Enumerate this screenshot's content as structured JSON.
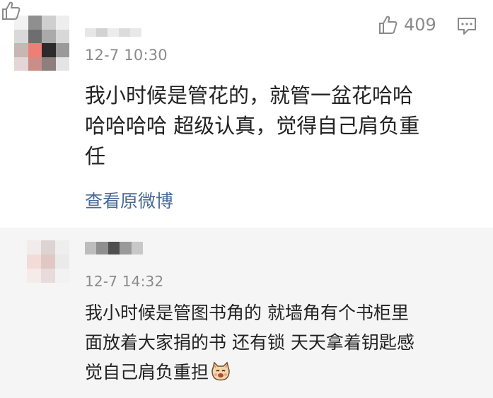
{
  "comments": [
    {
      "time": "12-7 10:30",
      "text_lines": [
        "我小时候是管花的，就管一盆花哈哈",
        "哈哈哈哈 超级认真，觉得自己肩负重",
        "任"
      ],
      "like_count": "409",
      "link_label": "查看原微博",
      "avatar_tiles": [
        "#f2f2f2",
        "#8f8f8f",
        "#cfcfcf",
        "#eeeeee",
        "#d9d9d9",
        "#6e6e6e",
        "#aaaaaa",
        "#d8d8d8",
        "#c7b6b4",
        "#ef7f76",
        "#2b2b2b",
        "#9a9a9a",
        "#e3d6d4",
        "#c98e88",
        "#8c7f7d",
        "#e4e4e4"
      ],
      "name_tiles": [
        "#e6e6e6",
        "#d2d2d2",
        "#ececec",
        "#dcdcdc",
        "#e8e8e8"
      ]
    },
    {
      "time": "12-7 14:32",
      "text_lines": [
        "我小时候是管图书角的 就墙角有个书柜里",
        "面放着大家捐的书 还有锁 天天拿着钥匙感",
        "觉自己肩负重担"
      ],
      "avatar_tiles": [
        "#f1eceb",
        "#dcd3d2",
        "#eeeeee",
        "#f3dcd8",
        "#e2c8c5",
        "#eaeaea",
        "#f5ecea",
        "#e7dcdb",
        "#f2f2f2"
      ],
      "name_tiles": [
        "#bdbdbd",
        "#8f8f8f",
        "#4f4f4f",
        "#9a9a9a",
        "#c8c8c8"
      ]
    }
  ],
  "colors": {
    "link": "#4a6a95",
    "meta": "#8a8a8a",
    "alt_bg": "#f5f5f5"
  },
  "icons": [
    "thumbs-up-icon",
    "comment-reply-icon",
    "cat-emoji-icon"
  ]
}
